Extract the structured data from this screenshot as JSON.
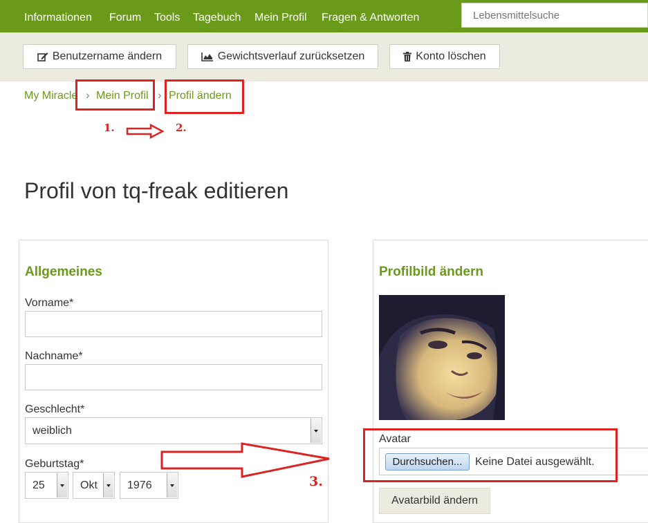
{
  "nav": {
    "items": [
      {
        "label": "Informationen"
      },
      {
        "label": "Forum"
      },
      {
        "label": "Tools"
      },
      {
        "label": "Tagebuch"
      },
      {
        "label": "Mein Profil"
      },
      {
        "label": "Fragen & Antworten"
      }
    ],
    "search_placeholder": "Lebensmittelsuche"
  },
  "actions": {
    "change_username": "Benutzername ändern",
    "reset_weight": "Gewichtsverlauf zurücksetzen",
    "delete_account": "Konto löschen"
  },
  "breadcrumb": {
    "items": [
      "My Miracle",
      "Mein Profil",
      "Profil ändern"
    ],
    "separator": "›"
  },
  "annotations": {
    "step1": "1.",
    "step2": "2.",
    "step3": "3."
  },
  "page": {
    "title": "Profil von tq-freak editieren"
  },
  "general": {
    "heading": "Allgemeines",
    "firstname_label": "Vorname*",
    "firstname_value": "",
    "lastname_label": "Nachname*",
    "lastname_value": "",
    "gender_label": "Geschlecht*",
    "gender_value": "weiblich",
    "birthday_label": "Geburtstag*",
    "birthday_day": "25",
    "birthday_month": "Okt",
    "birthday_year": "1976"
  },
  "avatar": {
    "heading": "Profilbild ändern",
    "field_label": "Avatar",
    "browse_label": "Durchsuchen...",
    "no_file": "Keine Datei ausgewählt.",
    "submit_label": "Avatarbild ändern"
  },
  "colors": {
    "accent": "#6a9a19",
    "annotation": "#dd2222",
    "actionbar_bg": "#ebebdf"
  }
}
